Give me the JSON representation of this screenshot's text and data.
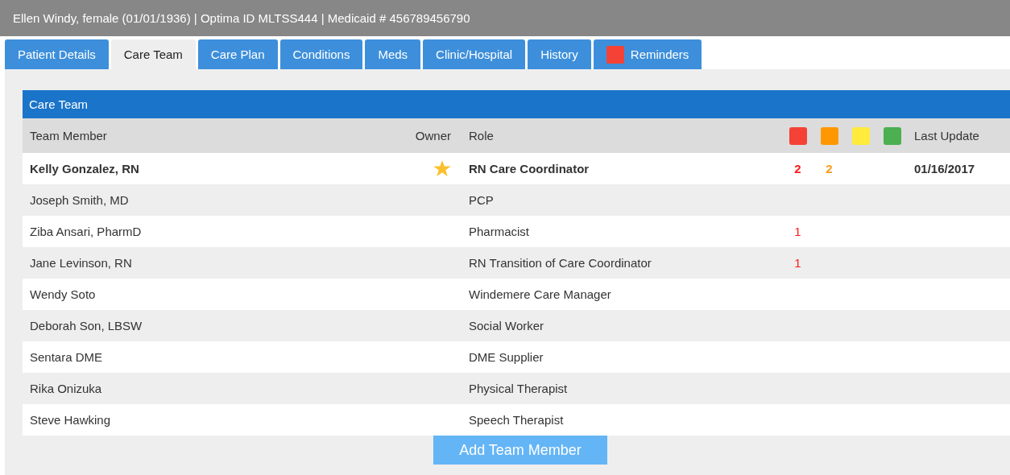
{
  "header": {
    "text": "Ellen Windy, female (01/01/1936) | Optima ID MLTSS444 | Medicaid # 456789456790"
  },
  "tabs": [
    {
      "label": "Patient Details",
      "selected": false,
      "kind": "plain"
    },
    {
      "label": "Care Team",
      "selected": true,
      "kind": "plain"
    },
    {
      "label": "Care Plan",
      "selected": false,
      "kind": "plain"
    },
    {
      "label": "Conditions",
      "selected": false,
      "kind": "plain"
    },
    {
      "label": "Meds",
      "selected": false,
      "kind": "plain"
    },
    {
      "label": "Clinic/Hospital",
      "selected": false,
      "kind": "plain"
    },
    {
      "label": "History",
      "selected": false,
      "kind": "plain"
    },
    {
      "label": "Reminders",
      "selected": false,
      "kind": "alert",
      "color": "#f44336"
    }
  ],
  "panel": {
    "title": "Care Team",
    "columns": {
      "member": "Team Member",
      "owner": "Owner",
      "role": "Role",
      "last_update": "Last Update"
    },
    "flag_columns": [
      {
        "color": "#f44336"
      },
      {
        "color": "#ff9800"
      },
      {
        "color": "#ffeb3b"
      },
      {
        "color": "#4caf50"
      }
    ],
    "rows": [
      {
        "name": "Kelly Gonzalez, RN",
        "owner": true,
        "role": "RN Care Coordinator",
        "highlighted": true,
        "flags": [
          {
            "count": "2",
            "color": "#ff1a1a"
          },
          {
            "count": "2",
            "color": "#ff9a1a"
          }
        ],
        "last_update": "01/16/2017"
      },
      {
        "name": "Joseph Smith, MD",
        "owner": false,
        "role": "PCP",
        "highlighted": false
      },
      {
        "name": "Ziba Ansari, PharmD",
        "owner": false,
        "role": "Pharmacist",
        "highlighted": false,
        "flags": [
          {
            "count": "1",
            "color": "#ff1a1a"
          }
        ]
      },
      {
        "name": "Jane Levinson, RN",
        "owner": false,
        "role": "RN Transition of Care Coordinator",
        "highlighted": false,
        "flags": [
          {
            "count": "1",
            "color": "#ff1a1a"
          }
        ]
      },
      {
        "name": "Wendy Soto",
        "owner": false,
        "role": "Windemere Care Manager",
        "highlighted": false
      },
      {
        "name": "Deborah Son, LBSW",
        "owner": false,
        "role": "Social Worker",
        "highlighted": false
      },
      {
        "name": "Sentara DME",
        "owner": false,
        "role": "DME Supplier",
        "highlighted": false
      },
      {
        "name": "Rika Onizuka",
        "owner": false,
        "role": "Physical Therapist",
        "highlighted": false
      },
      {
        "name": "Steve Hawking",
        "owner": false,
        "role": "Speech Therapist",
        "highlighted": false
      }
    ],
    "add_button": "Add Team Member"
  }
}
